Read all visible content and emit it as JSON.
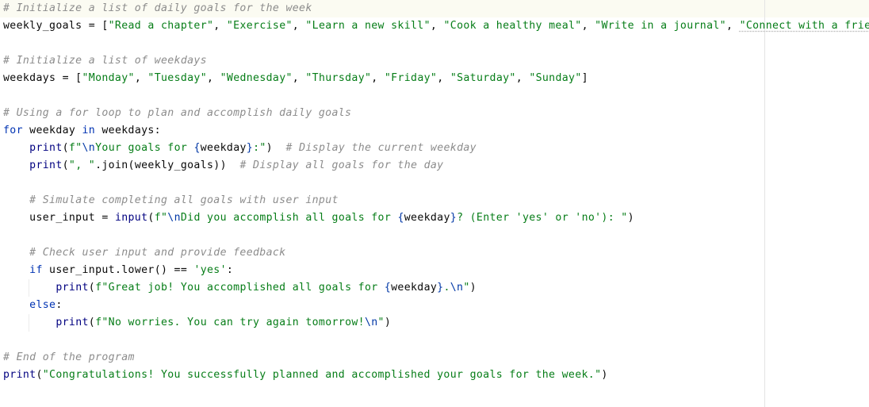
{
  "editor": {
    "language": "python",
    "lines": [
      [
        {
          "t": "cm",
          "v": "# Initialize a list of daily goals for the week"
        }
      ],
      [
        {
          "t": "tx",
          "v": "weekly_goals = ["
        },
        {
          "t": "st",
          "v": "\"Read a chapter\""
        },
        {
          "t": "tx",
          "v": ", "
        },
        {
          "t": "st",
          "v": "\"Exercise\""
        },
        {
          "t": "tx",
          "v": ", "
        },
        {
          "t": "st",
          "v": "\"Learn a new skill\""
        },
        {
          "t": "tx",
          "v": ", "
        },
        {
          "t": "st",
          "v": "\"Cook a healthy meal\""
        },
        {
          "t": "tx",
          "v": ", "
        },
        {
          "t": "st",
          "v": "\"Write in a journal\""
        },
        {
          "t": "tx",
          "v": ", "
        },
        {
          "t": "st",
          "v": "\"Connect with a friend\""
        },
        {
          "t": "tx",
          "v": ","
        }
      ],
      [],
      [
        {
          "t": "cm",
          "v": "# Initialize a list of weekdays"
        }
      ],
      [
        {
          "t": "tx",
          "v": "weekdays = ["
        },
        {
          "t": "st",
          "v": "\"Monday\""
        },
        {
          "t": "tx",
          "v": ", "
        },
        {
          "t": "st",
          "v": "\"Tuesday\""
        },
        {
          "t": "tx",
          "v": ", "
        },
        {
          "t": "st",
          "v": "\"Wednesday\""
        },
        {
          "t": "tx",
          "v": ", "
        },
        {
          "t": "st",
          "v": "\"Thursday\""
        },
        {
          "t": "tx",
          "v": ", "
        },
        {
          "t": "st",
          "v": "\"Friday\""
        },
        {
          "t": "tx",
          "v": ", "
        },
        {
          "t": "st",
          "v": "\"Saturday\""
        },
        {
          "t": "tx",
          "v": ", "
        },
        {
          "t": "st",
          "v": "\"Sunday\""
        },
        {
          "t": "tx",
          "v": "]"
        }
      ],
      [],
      [
        {
          "t": "cm",
          "v": "# Using a for loop to plan and accomplish daily goals"
        }
      ],
      [
        {
          "t": "kw",
          "v": "for"
        },
        {
          "t": "tx",
          "v": " weekday "
        },
        {
          "t": "kw",
          "v": "in"
        },
        {
          "t": "tx",
          "v": " weekdays:"
        }
      ],
      [
        {
          "t": "tx",
          "v": "    "
        },
        {
          "t": "fn",
          "v": "print"
        },
        {
          "t": "tx",
          "v": "("
        },
        {
          "t": "st",
          "v": "f\""
        },
        {
          "t": "es",
          "v": "\\n"
        },
        {
          "t": "st",
          "v": "Your goals for "
        },
        {
          "t": "br",
          "v": "{"
        },
        {
          "t": "tx",
          "v": "weekday"
        },
        {
          "t": "br",
          "v": "}"
        },
        {
          "t": "st",
          "v": ":\""
        },
        {
          "t": "tx",
          "v": ")  "
        },
        {
          "t": "cm",
          "v": "# Display the current weekday"
        }
      ],
      [
        {
          "t": "tx",
          "v": "    "
        },
        {
          "t": "fn",
          "v": "print"
        },
        {
          "t": "tx",
          "v": "("
        },
        {
          "t": "st",
          "v": "\", \""
        },
        {
          "t": "tx",
          "v": ".join(weekly_goals))  "
        },
        {
          "t": "cm",
          "v": "# Display all goals for the day"
        }
      ],
      [],
      [
        {
          "t": "tx",
          "v": "    "
        },
        {
          "t": "cm",
          "v": "# Simulate completing all goals with user input"
        }
      ],
      [
        {
          "t": "tx",
          "v": "    user_input = "
        },
        {
          "t": "fn",
          "v": "input"
        },
        {
          "t": "tx",
          "v": "("
        },
        {
          "t": "st",
          "v": "f\""
        },
        {
          "t": "es",
          "v": "\\n"
        },
        {
          "t": "st",
          "v": "Did you accomplish all goals for "
        },
        {
          "t": "br",
          "v": "{"
        },
        {
          "t": "tx",
          "v": "weekday"
        },
        {
          "t": "br",
          "v": "}"
        },
        {
          "t": "st",
          "v": "? (Enter 'yes' or 'no'): \""
        },
        {
          "t": "tx",
          "v": ")"
        }
      ],
      [],
      [
        {
          "t": "tx",
          "v": "    "
        },
        {
          "t": "cm",
          "v": "# Check user input and provide feedback"
        }
      ],
      [
        {
          "t": "tx",
          "v": "    "
        },
        {
          "t": "kw",
          "v": "if"
        },
        {
          "t": "tx",
          "v": " user_input.lower() == "
        },
        {
          "t": "st",
          "v": "'yes'"
        },
        {
          "t": "tx",
          "v": ":"
        }
      ],
      [
        {
          "t": "tx",
          "v": "        "
        },
        {
          "t": "fn",
          "v": "print"
        },
        {
          "t": "tx",
          "v": "("
        },
        {
          "t": "st",
          "v": "f\"Great job! You accomplished all goals for "
        },
        {
          "t": "br",
          "v": "{"
        },
        {
          "t": "tx",
          "v": "weekday"
        },
        {
          "t": "br",
          "v": "}"
        },
        {
          "t": "st",
          "v": "."
        },
        {
          "t": "es",
          "v": "\\n"
        },
        {
          "t": "st",
          "v": "\""
        },
        {
          "t": "tx",
          "v": ")"
        }
      ],
      [
        {
          "t": "tx",
          "v": "    "
        },
        {
          "t": "kw",
          "v": "else"
        },
        {
          "t": "tx",
          "v": ":"
        }
      ],
      [
        {
          "t": "tx",
          "v": "        "
        },
        {
          "t": "fn",
          "v": "print"
        },
        {
          "t": "tx",
          "v": "("
        },
        {
          "t": "st",
          "v": "f\"No worries. You can try again tomorrow!"
        },
        {
          "t": "es",
          "v": "\\n"
        },
        {
          "t": "st",
          "v": "\""
        },
        {
          "t": "tx",
          "v": ")"
        }
      ],
      [],
      [
        {
          "t": "cm",
          "v": "# End of the program"
        }
      ],
      [
        {
          "t": "fn",
          "v": "print"
        },
        {
          "t": "tx",
          "v": "("
        },
        {
          "t": "st",
          "v": "\"Congratulations! You successfully planned and accomplished your goals for the week.\""
        },
        {
          "t": "tx",
          "v": ")"
        }
      ]
    ]
  }
}
